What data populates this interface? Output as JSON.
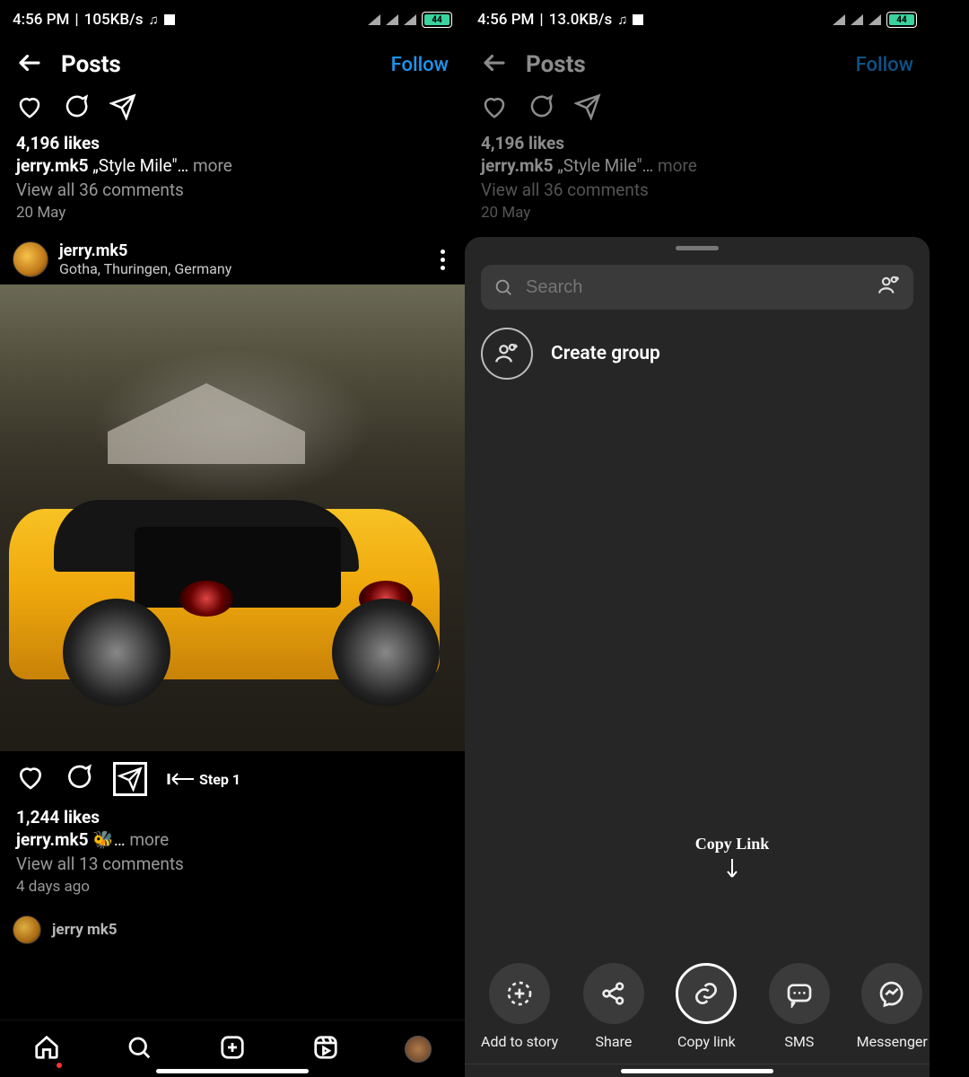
{
  "left": {
    "status": {
      "time": "4:56 PM",
      "speed": "105KB/s",
      "battery": "44"
    },
    "header": {
      "title": "Posts",
      "follow": "Follow"
    },
    "prev_post": {
      "likes": "4,196 likes",
      "user": "jerry.mk5",
      "caption": "„Style Mile\"…",
      "more": "more",
      "comments": "View all 36 comments",
      "date": "20 May"
    },
    "post": {
      "user": "jerry.mk5",
      "location": "Gotha, Thuringen, Germany",
      "likes": "1,244 likes",
      "caption_user": "jerry.mk5",
      "caption_emoji": "🐝…",
      "caption_more": "more",
      "comments": "View all 13 comments",
      "date": "4 days ago"
    },
    "annotation": {
      "step1": "Step 1"
    },
    "next_post_user": "jerry mk5"
  },
  "right": {
    "status": {
      "time": "4:56 PM",
      "speed": "13.0KB/s",
      "battery": "44"
    },
    "header": {
      "title": "Posts",
      "follow": "Follow"
    },
    "prev_post": {
      "likes": "4,196 likes",
      "user": "jerry.mk5",
      "caption": "„Style Mile\"…",
      "more": "more",
      "comments": "View all 36 comments",
      "date": "20 May"
    },
    "sheet": {
      "search_placeholder": "Search",
      "create_group": "Create group",
      "annotation": "Copy Link",
      "options": [
        {
          "label": "Add to story",
          "icon": "add-story"
        },
        {
          "label": "Share",
          "icon": "share"
        },
        {
          "label": "Copy link",
          "icon": "link",
          "highlight": true
        },
        {
          "label": "SMS",
          "icon": "sms"
        },
        {
          "label": "Messenger",
          "icon": "messenger"
        }
      ]
    }
  }
}
